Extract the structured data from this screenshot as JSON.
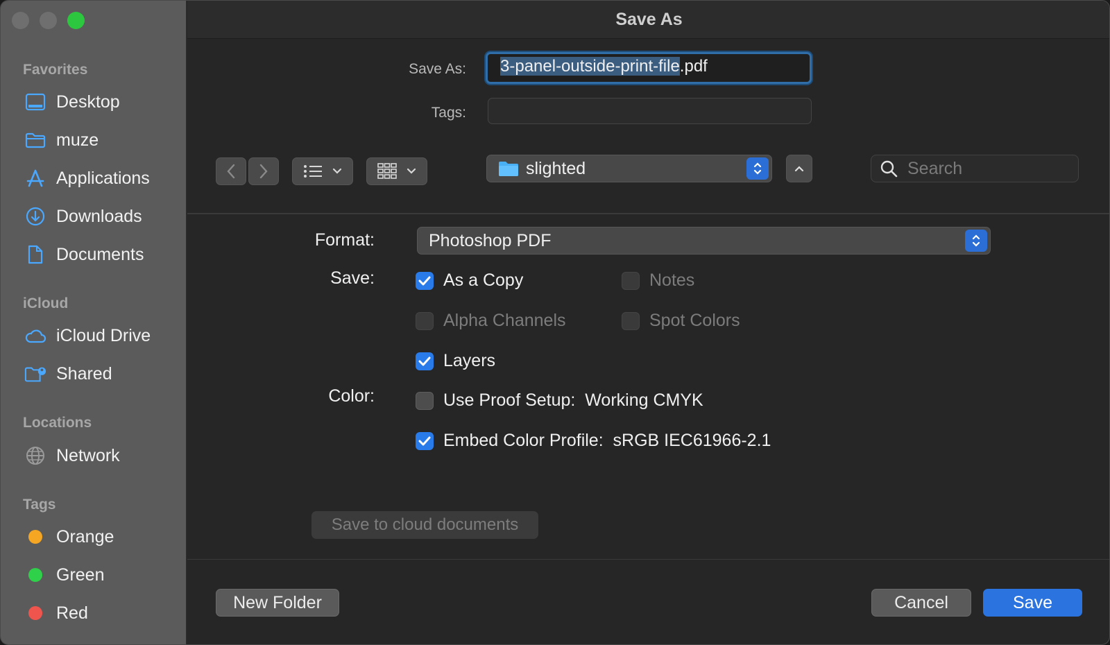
{
  "window": {
    "title": "Save As"
  },
  "sidebar": {
    "sections": [
      {
        "title": "Favorites",
        "items": [
          {
            "label": "Desktop",
            "icon": "desktop-icon"
          },
          {
            "label": "muze",
            "icon": "folder-icon"
          },
          {
            "label": "Applications",
            "icon": "applications-icon"
          },
          {
            "label": "Downloads",
            "icon": "download-icon"
          },
          {
            "label": "Documents",
            "icon": "document-icon"
          }
        ]
      },
      {
        "title": "iCloud",
        "items": [
          {
            "label": "iCloud Drive",
            "icon": "cloud-icon"
          },
          {
            "label": "Shared",
            "icon": "shared-folder-icon"
          }
        ]
      },
      {
        "title": "Locations",
        "items": [
          {
            "label": "Network",
            "icon": "globe-icon"
          }
        ]
      },
      {
        "title": "Tags",
        "items": [
          {
            "label": "Orange",
            "color": "#f5a623"
          },
          {
            "label": "Green",
            "color": "#2fd14a"
          },
          {
            "label": "Red",
            "color": "#f0554d"
          }
        ]
      }
    ]
  },
  "save_as": {
    "label": "Save As:",
    "filename_selected": "3-panel-outside-print-file",
    "filename_ext": ".pdf"
  },
  "tags": {
    "label": "Tags:",
    "value": ""
  },
  "location": {
    "folder": "slighted"
  },
  "search": {
    "placeholder": "Search"
  },
  "options": {
    "format_label": "Format:",
    "format_value": "Photoshop PDF",
    "save_label": "Save:",
    "color_label": "Color:",
    "checkboxes": {
      "as_a_copy": {
        "label": "As a Copy",
        "checked": true,
        "enabled": true
      },
      "notes": {
        "label": "Notes",
        "checked": false,
        "enabled": false
      },
      "alpha_channels": {
        "label": "Alpha Channels",
        "checked": false,
        "enabled": false
      },
      "spot_colors": {
        "label": "Spot Colors",
        "checked": false,
        "enabled": false
      },
      "layers": {
        "label": "Layers",
        "checked": true,
        "enabled": true
      },
      "use_proof_setup": {
        "label": "Use Proof Setup:  Working CMYK",
        "checked": false,
        "enabled": true
      },
      "embed_color_profile": {
        "label": "Embed Color Profile:  sRGB IEC61966-2.1",
        "checked": true,
        "enabled": true
      }
    },
    "cloud_button": "Save to cloud documents"
  },
  "footer": {
    "new_folder": "New Folder",
    "cancel": "Cancel",
    "save": "Save"
  },
  "colors": {
    "accent": "#2b74e0",
    "traffic_max": "#2dc63f"
  }
}
